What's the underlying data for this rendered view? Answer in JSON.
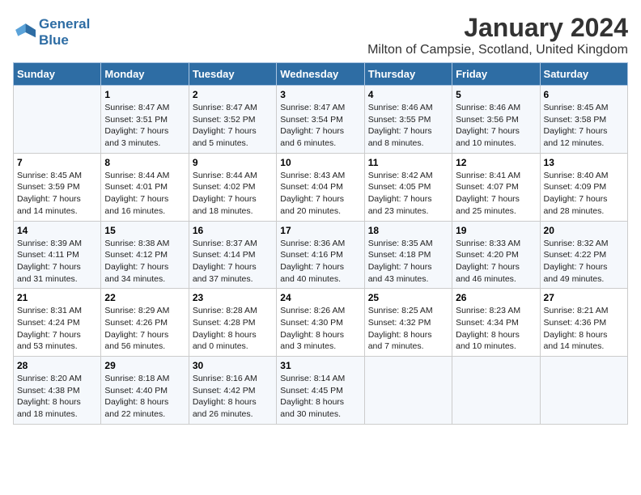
{
  "header": {
    "logo_line1": "General",
    "logo_line2": "Blue",
    "title": "January 2024",
    "subtitle": "Milton of Campsie, Scotland, United Kingdom"
  },
  "days_of_week": [
    "Sunday",
    "Monday",
    "Tuesday",
    "Wednesday",
    "Thursday",
    "Friday",
    "Saturday"
  ],
  "weeks": [
    [
      {
        "day": "",
        "info": ""
      },
      {
        "day": "1",
        "info": "Sunrise: 8:47 AM\nSunset: 3:51 PM\nDaylight: 7 hours\nand 3 minutes."
      },
      {
        "day": "2",
        "info": "Sunrise: 8:47 AM\nSunset: 3:52 PM\nDaylight: 7 hours\nand 5 minutes."
      },
      {
        "day": "3",
        "info": "Sunrise: 8:47 AM\nSunset: 3:54 PM\nDaylight: 7 hours\nand 6 minutes."
      },
      {
        "day": "4",
        "info": "Sunrise: 8:46 AM\nSunset: 3:55 PM\nDaylight: 7 hours\nand 8 minutes."
      },
      {
        "day": "5",
        "info": "Sunrise: 8:46 AM\nSunset: 3:56 PM\nDaylight: 7 hours\nand 10 minutes."
      },
      {
        "day": "6",
        "info": "Sunrise: 8:45 AM\nSunset: 3:58 PM\nDaylight: 7 hours\nand 12 minutes."
      }
    ],
    [
      {
        "day": "7",
        "info": "Sunrise: 8:45 AM\nSunset: 3:59 PM\nDaylight: 7 hours\nand 14 minutes."
      },
      {
        "day": "8",
        "info": "Sunrise: 8:44 AM\nSunset: 4:01 PM\nDaylight: 7 hours\nand 16 minutes."
      },
      {
        "day": "9",
        "info": "Sunrise: 8:44 AM\nSunset: 4:02 PM\nDaylight: 7 hours\nand 18 minutes."
      },
      {
        "day": "10",
        "info": "Sunrise: 8:43 AM\nSunset: 4:04 PM\nDaylight: 7 hours\nand 20 minutes."
      },
      {
        "day": "11",
        "info": "Sunrise: 8:42 AM\nSunset: 4:05 PM\nDaylight: 7 hours\nand 23 minutes."
      },
      {
        "day": "12",
        "info": "Sunrise: 8:41 AM\nSunset: 4:07 PM\nDaylight: 7 hours\nand 25 minutes."
      },
      {
        "day": "13",
        "info": "Sunrise: 8:40 AM\nSunset: 4:09 PM\nDaylight: 7 hours\nand 28 minutes."
      }
    ],
    [
      {
        "day": "14",
        "info": "Sunrise: 8:39 AM\nSunset: 4:11 PM\nDaylight: 7 hours\nand 31 minutes."
      },
      {
        "day": "15",
        "info": "Sunrise: 8:38 AM\nSunset: 4:12 PM\nDaylight: 7 hours\nand 34 minutes."
      },
      {
        "day": "16",
        "info": "Sunrise: 8:37 AM\nSunset: 4:14 PM\nDaylight: 7 hours\nand 37 minutes."
      },
      {
        "day": "17",
        "info": "Sunrise: 8:36 AM\nSunset: 4:16 PM\nDaylight: 7 hours\nand 40 minutes."
      },
      {
        "day": "18",
        "info": "Sunrise: 8:35 AM\nSunset: 4:18 PM\nDaylight: 7 hours\nand 43 minutes."
      },
      {
        "day": "19",
        "info": "Sunrise: 8:33 AM\nSunset: 4:20 PM\nDaylight: 7 hours\nand 46 minutes."
      },
      {
        "day": "20",
        "info": "Sunrise: 8:32 AM\nSunset: 4:22 PM\nDaylight: 7 hours\nand 49 minutes."
      }
    ],
    [
      {
        "day": "21",
        "info": "Sunrise: 8:31 AM\nSunset: 4:24 PM\nDaylight: 7 hours\nand 53 minutes."
      },
      {
        "day": "22",
        "info": "Sunrise: 8:29 AM\nSunset: 4:26 PM\nDaylight: 7 hours\nand 56 minutes."
      },
      {
        "day": "23",
        "info": "Sunrise: 8:28 AM\nSunset: 4:28 PM\nDaylight: 8 hours\nand 0 minutes."
      },
      {
        "day": "24",
        "info": "Sunrise: 8:26 AM\nSunset: 4:30 PM\nDaylight: 8 hours\nand 3 minutes."
      },
      {
        "day": "25",
        "info": "Sunrise: 8:25 AM\nSunset: 4:32 PM\nDaylight: 8 hours\nand 7 minutes."
      },
      {
        "day": "26",
        "info": "Sunrise: 8:23 AM\nSunset: 4:34 PM\nDaylight: 8 hours\nand 10 minutes."
      },
      {
        "day": "27",
        "info": "Sunrise: 8:21 AM\nSunset: 4:36 PM\nDaylight: 8 hours\nand 14 minutes."
      }
    ],
    [
      {
        "day": "28",
        "info": "Sunrise: 8:20 AM\nSunset: 4:38 PM\nDaylight: 8 hours\nand 18 minutes."
      },
      {
        "day": "29",
        "info": "Sunrise: 8:18 AM\nSunset: 4:40 PM\nDaylight: 8 hours\nand 22 minutes."
      },
      {
        "day": "30",
        "info": "Sunrise: 8:16 AM\nSunset: 4:42 PM\nDaylight: 8 hours\nand 26 minutes."
      },
      {
        "day": "31",
        "info": "Sunrise: 8:14 AM\nSunset: 4:45 PM\nDaylight: 8 hours\nand 30 minutes."
      },
      {
        "day": "",
        "info": ""
      },
      {
        "day": "",
        "info": ""
      },
      {
        "day": "",
        "info": ""
      }
    ]
  ]
}
